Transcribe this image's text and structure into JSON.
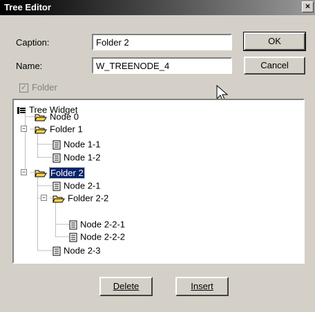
{
  "window": {
    "title": "Tree Editor",
    "close_label": "×"
  },
  "form": {
    "caption_label": "Caption:",
    "caption_value": "Folder 2",
    "name_label": "Name:",
    "name_value": "W_TREENODE_4",
    "folder_label": "Folder",
    "folder_checked": true
  },
  "buttons": {
    "ok": "OK",
    "cancel": "Cancel",
    "delete": "Delete",
    "insert": "Insert"
  },
  "tree": {
    "root": "Tree Widget",
    "node0": "Node 0",
    "folder1": "Folder 1",
    "node1_1": "Node 1-1",
    "node1_2": "Node 1-2",
    "folder2": "Folder 2",
    "node2_1": "Node 2-1",
    "folder2_2": "Folder 2-2",
    "node2_2_1": "Node 2-2-1",
    "node2_2_2": "Node 2-2-2",
    "node2_3": "Node 2-3"
  }
}
